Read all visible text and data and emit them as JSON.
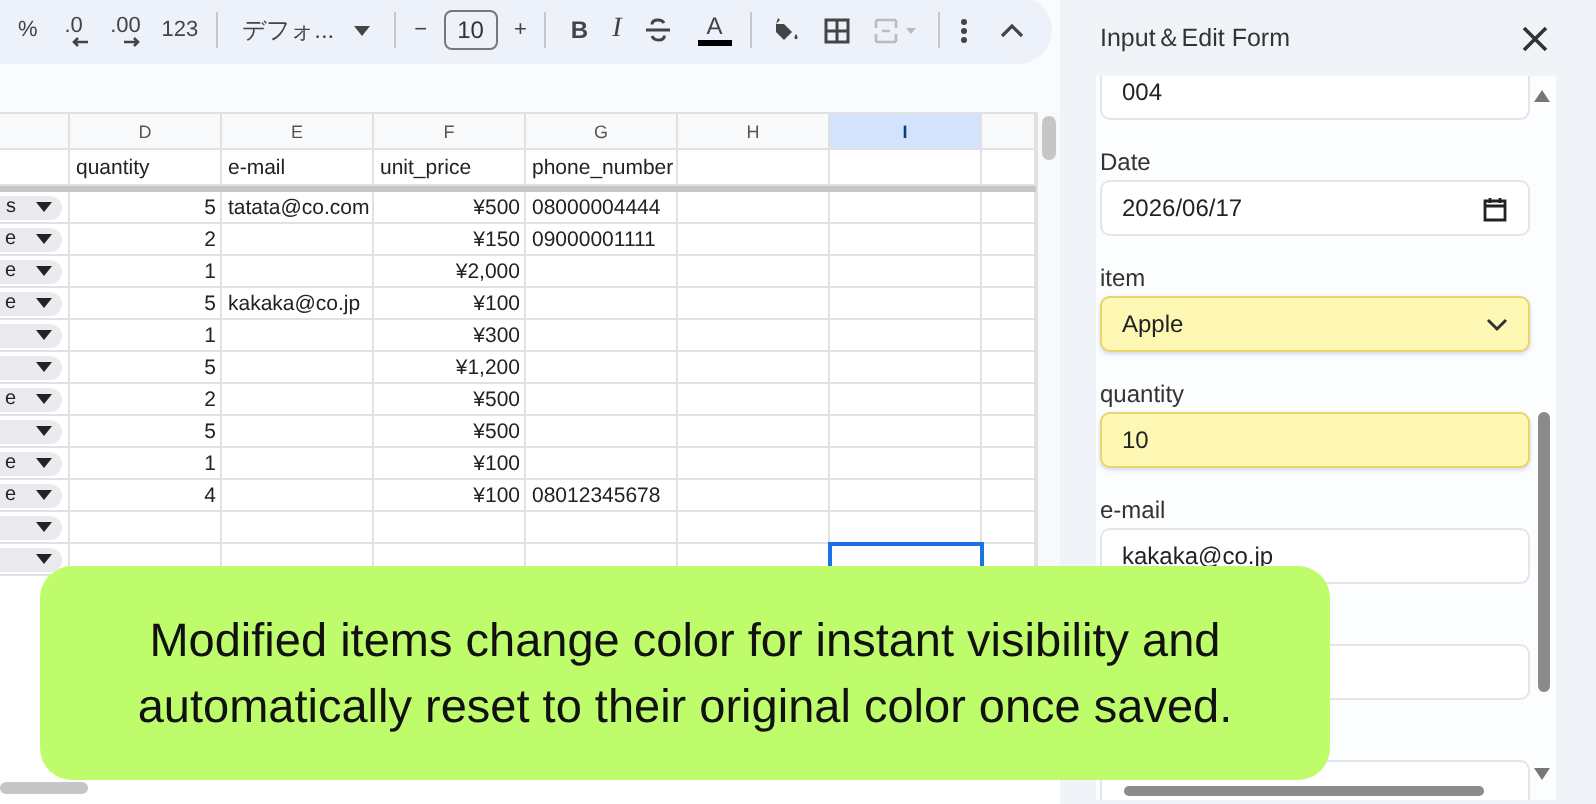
{
  "toolbar": {
    "items": [
      {
        "kind": "text",
        "label": "%"
      },
      {
        "kind": "decrease",
        "label": ".0"
      },
      {
        "kind": "increase",
        "label": ".00"
      },
      {
        "kind": "text",
        "label": "123"
      },
      {
        "kind": "separator"
      },
      {
        "kind": "font",
        "label": "デフォ..."
      },
      {
        "kind": "separator"
      },
      {
        "kind": "text",
        "label": "−"
      },
      {
        "kind": "size",
        "value": "10"
      },
      {
        "kind": "text",
        "label": "+"
      },
      {
        "kind": "separator"
      },
      {
        "kind": "bold",
        "label": "B"
      },
      {
        "kind": "italic",
        "label": "I"
      },
      {
        "kind": "strike"
      },
      {
        "kind": "color",
        "label": "A"
      },
      {
        "kind": "separator"
      },
      {
        "kind": "fill"
      },
      {
        "kind": "borders"
      },
      {
        "kind": "merge"
      },
      {
        "kind": "separator"
      },
      {
        "kind": "more"
      },
      {
        "kind": "collapse"
      }
    ]
  },
  "sheet": {
    "columns": [
      {
        "letter": "D",
        "selected": false
      },
      {
        "letter": "E",
        "selected": false
      },
      {
        "letter": "F",
        "selected": false
      },
      {
        "letter": "G",
        "selected": false
      },
      {
        "letter": "H",
        "selected": false
      },
      {
        "letter": "I",
        "selected": true
      }
    ],
    "header_row": [
      "quantity",
      "e-mail",
      "unit_price",
      "phone_number"
    ],
    "rows": [
      {
        "chip": "s",
        "quantity": "5",
        "e_mail": "tatata@co.com",
        "unit_price": "¥500",
        "phone_number": "08000004444",
        "cursor": false
      },
      {
        "chip": "e",
        "quantity": "2",
        "unit_price": "¥150",
        "phone_number": "09000001111",
        "cursor": false
      },
      {
        "chip": "e",
        "quantity": "1",
        "unit_price": "¥2,000",
        "cursor": false
      },
      {
        "chip": "e",
        "quantity": "5",
        "e_mail": "kakaka@co.jp",
        "unit_price": "¥100",
        "cursor": false
      },
      {
        "quantity": "1",
        "unit_price": "¥300",
        "cursor": false
      },
      {
        "quantity": "5",
        "unit_price": "¥1,200",
        "cursor": false
      },
      {
        "chip": "e",
        "quantity": "2",
        "unit_price": "¥500",
        "cursor": false
      },
      {
        "quantity": "5",
        "unit_price": "¥500",
        "cursor": false
      },
      {
        "chip": "e",
        "quantity": "1",
        "unit_price": "¥100",
        "cursor": false
      },
      {
        "chip": "e",
        "quantity": "4",
        "unit_price": "¥100",
        "phone_number": "08012345678",
        "cursor": false
      },
      {
        "cursor": false
      },
      {
        "cursor": true
      }
    ]
  },
  "form": {
    "title": "Input＆Edit Form",
    "fields": [
      {
        "kind": "text",
        "value": "004",
        "modified": false
      },
      {
        "label": "Date",
        "kind": "date",
        "value": "2026/06/17",
        "modified": false
      },
      {
        "label": "item",
        "kind": "select",
        "value": "Apple",
        "modified": true
      },
      {
        "label": "quantity",
        "kind": "text",
        "value": "10",
        "modified": true
      },
      {
        "label": "e-mail",
        "kind": "text",
        "value": "kakaka@co.jp",
        "modified": false
      },
      {
        "kind": "text",
        "modified": false
      },
      {
        "kind": "text",
        "modified": false
      }
    ]
  },
  "callout": {
    "text": "Modified items change color for instant visibility and automatically reset to their original color once saved."
  }
}
